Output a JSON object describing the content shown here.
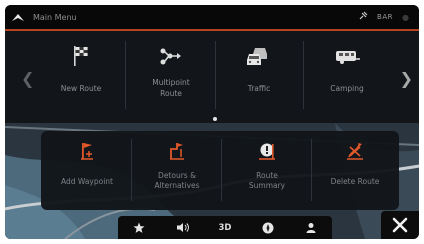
{
  "topbar": {
    "title": "Main Menu",
    "status_text": "BAR",
    "home_icon": "up-arrow-icon",
    "satellite_icon": "satellite-icon"
  },
  "menu": {
    "items": [
      {
        "label": "New Route",
        "icon": "checkered-flag-icon"
      },
      {
        "label": "Multipoint\nRoute",
        "icon": "multipoint-route-icon"
      },
      {
        "label": "Traffic",
        "icon": "traffic-icon"
      },
      {
        "label": "Camping",
        "icon": "caravan-icon"
      }
    ],
    "page_count": 2,
    "active_page": 1
  },
  "submenu": {
    "items": [
      {
        "label": "Add Waypoint",
        "icon": "add-waypoint-icon"
      },
      {
        "label": "Detours &\nAlternatives",
        "icon": "detours-icon"
      },
      {
        "label": "Route\nSummary",
        "icon": "route-summary-icon"
      },
      {
        "label": "Delete Route",
        "icon": "delete-route-icon"
      }
    ]
  },
  "bottom_bar": {
    "view_mode_label": "3D",
    "buttons": [
      "star-icon",
      "speaker-icon",
      "3d-toggle",
      "compass-icon",
      "person-icon"
    ]
  },
  "colors": {
    "accent": "#b8431f",
    "icon_orange": "#e0582a",
    "panel": "#12161a",
    "text": "#8c8f92"
  }
}
